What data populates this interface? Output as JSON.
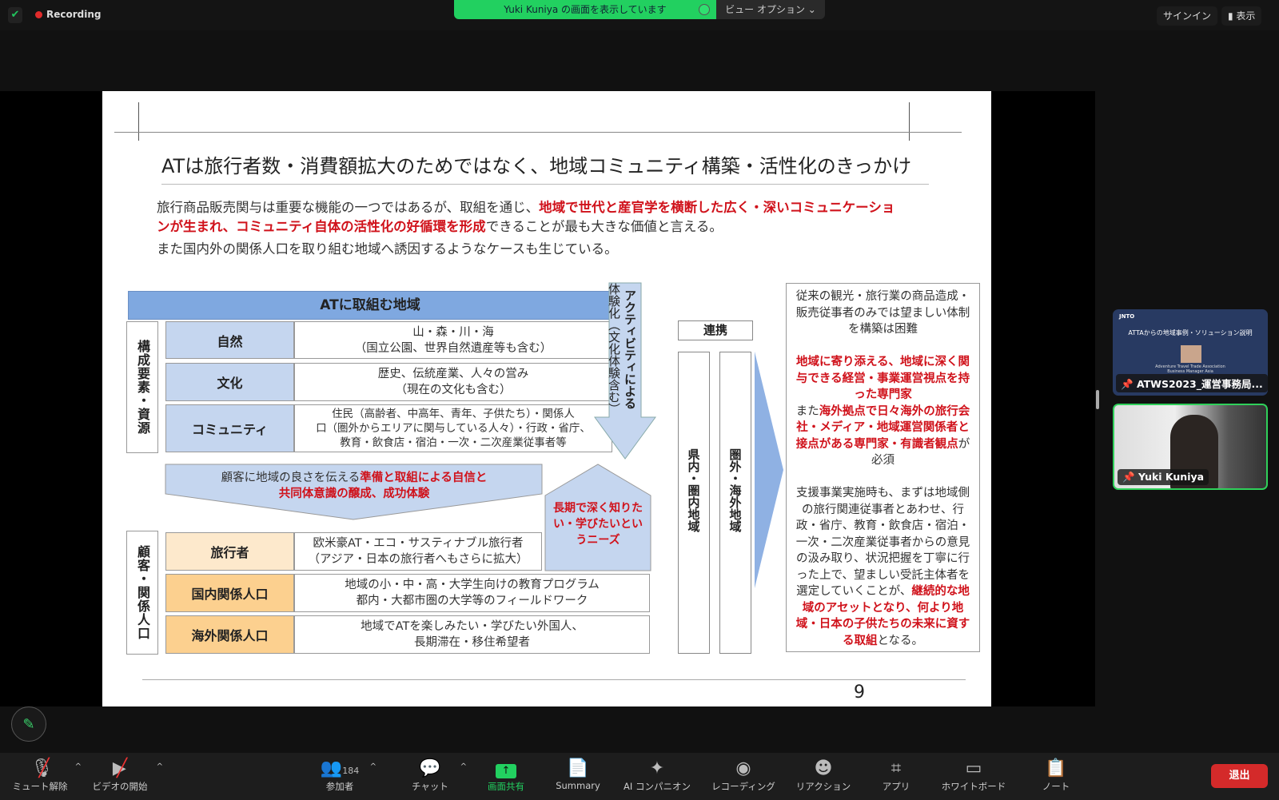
{
  "topbar": {
    "recording": "Recording",
    "share_notice": "Yuki Kuniya の画面を表示しています",
    "view_options": "ビュー オプション ⌄",
    "sign_in": "サインイン",
    "display": "表示"
  },
  "slide": {
    "title": "ATは旅行者数・消費額拡大のためではなく、地域コミュニティ構築・活性化のきっかけ",
    "para1a": "旅行商品販売関与は重要な機能の一つではあるが、取組を通じ、",
    "para1b": "地域で世代と産官学を横断した広く・深いコミュニケーショ",
    "para2a": "ンが生まれ、コミュニティ自体の活性化の好循環を形成",
    "para2b": "できることが最も大きな価値と言える。",
    "para3": "また国内外の関係人口を取り組む地域へ誘因するようなケースも生じている。",
    "region_header": "ATに取組む地域",
    "resources_label": "構成要素・資源",
    "resources": [
      {
        "label": "自然",
        "lines": [
          "山・森・川・海",
          "（国立公園、世界自然遺産等も含む）"
        ]
      },
      {
        "label": "文化",
        "lines": [
          "歴史、伝統産業、人々の営み",
          "（現在の文化も含む）"
        ]
      },
      {
        "label": "コミュニティ",
        "lines": [
          "住民（高齢者、中高年、青年、子供たち）・関係人",
          "口（圏外からエリアに関与している人々）・行政・省庁、",
          "教育・飲食店・宿泊・一次・二次産業従事者等"
        ]
      }
    ],
    "activity_arrow_1": "アクティビティによる",
    "activity_arrow_2": "体験化（文化体験含む）",
    "banner_a": "顧客に地域の良さを伝える",
    "banner_b": "準備と取組による自信と",
    "banner_c": "共同体意識の醸成、成功体験",
    "needs": "長期で深く知りたい・学びたいというニーズ",
    "customers_label": "顧客・関係人口",
    "customers": [
      {
        "label": "旅行者",
        "lines": [
          "欧米豪AT・エコ・サスティナブル旅行者",
          "（アジア・日本の旅行者へもさらに拡大）"
        ],
        "color": "#fde9cc"
      },
      {
        "label": "国内関係人口",
        "lines": [
          "地域の小・中・高・大学生向けの教育プログラム",
          "都内・大都市圏の大学等のフィールドワーク"
        ],
        "color": "#fcd08f"
      },
      {
        "label": "海外関係人口",
        "lines": [
          "地域でATを楽しみたい・学びたい外国人、",
          "長期滞在・移住希望者"
        ],
        "color": "#fcd08f"
      }
    ],
    "collab": "連携",
    "col_inner": "県内・圏内地域",
    "col_outer": "圏外・海外地域",
    "right": {
      "p1": "従来の観光・旅行業の商品造成・販売従事者のみでは望ましい体制を構築は困難",
      "p2red": "地域に寄り添える、地域に深く関与できる経営・事業運営視点を持った専門家",
      "p3a": "また",
      "p3red": "海外拠点で日々海外の旅行会社・メディア・地域運営関係者と接点がある専門家・有識者観点",
      "p3b": "が必須",
      "p4": "支援事業実施時も、まずは地域側の旅行関連従事者とあわせ、行政・省庁、教育・飲食店・宿泊・一次・二次産業従事者からの意見の汲み取り、状況把握を丁寧に行った上で、望ましい受託主体者を選定していくことが、",
      "p4red": "継続的な地域のアセットとなり、何より地域・日本の子供たちの未来に資する取組",
      "p4b": "となる。"
    },
    "page_number": "9"
  },
  "participants": [
    {
      "name": "ATWS2023_運営事務局...",
      "thumb_title": "ATTAからの地域事例・ソリューション説明",
      "thumb_logo": "JNTO",
      "thumb_sub1": "Adventure Travel Trade Association",
      "thumb_sub2": "Business Manager Asia"
    },
    {
      "name": "Yuki Kuniya",
      "active": true
    }
  ],
  "toolbar": {
    "unmute": "ミュート解除",
    "start_video": "ビデオの開始",
    "participants": "参加者",
    "participant_count": "184",
    "chat": "チャット",
    "share": "画面共有",
    "summary": "Summary",
    "ai": "AI コンパニオン",
    "record": "レコーディング",
    "reactions": "リアクション",
    "apps": "アプリ",
    "whiteboard": "ホワイトボード",
    "notes": "ノート",
    "leave": "退出"
  },
  "colors": {
    "accent_green": "#22d060",
    "leave_red": "#d42a2a",
    "slide_red": "#d0121b",
    "slide_blue": "#7fa8e0"
  }
}
